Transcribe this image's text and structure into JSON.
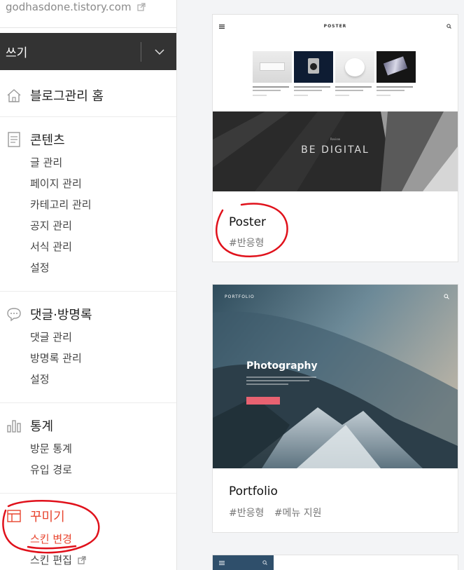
{
  "sidebar": {
    "blog_url": "godhasdone.tistory.com",
    "write_label": "쓰기",
    "groups": [
      {
        "title": "블로그관리 홈",
        "icon": "home-icon",
        "items": []
      },
      {
        "title": "콘텐츠",
        "icon": "document-icon",
        "items": [
          "글 관리",
          "페이지 관리",
          "카테고리 관리",
          "공지 관리",
          "서식 관리",
          "설정"
        ]
      },
      {
        "title": "댓글·방명록",
        "icon": "comment-icon",
        "items": [
          "댓글 관리",
          "방명록 관리",
          "설정"
        ]
      },
      {
        "title": "통계",
        "icon": "chart-icon",
        "items": [
          "방문 통계",
          "유입 경로"
        ]
      },
      {
        "title": "꾸미기",
        "icon": "layout-icon",
        "items": [
          "스킨 변경",
          "스킨 편집"
        ]
      }
    ]
  },
  "skins": [
    {
      "name": "Poster",
      "tags": [
        "#반응형"
      ],
      "preview": {
        "logo": "POSTER",
        "banner_small": "Review",
        "banner_title": "BE DIGITAL",
        "colors": {
          "banner": "#2b2b2b"
        }
      }
    },
    {
      "name": "Portfolio",
      "tags": [
        "#반응형",
        "#메뉴 지원"
      ],
      "preview": {
        "logo": "PORTFOLIO",
        "hero_title": "Photography"
      }
    }
  ],
  "colors": {
    "accent": "#e8452f",
    "write_bg": "#333333",
    "annotation": "#e0111b"
  }
}
